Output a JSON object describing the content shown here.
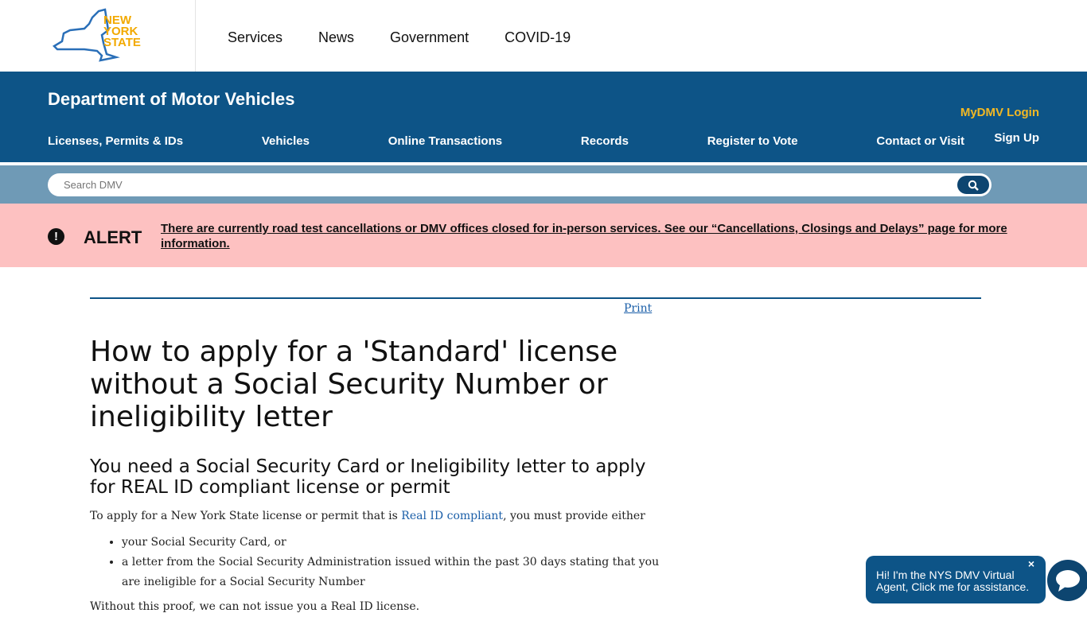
{
  "header": {
    "logo_text": "NEW YORK STATE",
    "nav": [
      "Services",
      "News",
      "Government",
      "COVID-19"
    ]
  },
  "dmv": {
    "title": "Department of Motor Vehicles",
    "mydmv_login": "MyDMV Login",
    "sign_up": "Sign Up",
    "nav": [
      "Licenses, Permits & IDs",
      "Vehicles",
      "Online Transactions",
      "Records",
      "Register to Vote",
      "Contact or Visit"
    ]
  },
  "search": {
    "placeholder": "Search DMV"
  },
  "alert": {
    "label": "ALERT",
    "text": "There are currently road test cancellations or DMV offices closed for in-person services. See our “Cancellations, Closings and Delays” page for more information."
  },
  "content": {
    "print": "Print",
    "title": "How to apply for a 'Standard' license without a Social Security Number or ineligibility letter",
    "subtitle": "You need a Social Security Card or Ineligibility letter to apply for REAL ID compliant license or permit",
    "intro_before": "To apply for a New York State license or permit that is ",
    "intro_link": "Real ID compliant",
    "intro_after": ", you must provide either",
    "bullets": [
      "your Social Security Card, or",
      "a letter from the Social Security Administration issued within the past 30 days stating that you are ineligible for a Social Security Number"
    ],
    "after": "Without this proof, we can not issue you a Real ID license."
  },
  "chat": {
    "text": "Hi! I'm the NYS DMV Virtual Agent, Click me for assistance.",
    "close": "×"
  },
  "colors": {
    "brand": "#0d5487",
    "gold": "#f2b824",
    "alert_bg": "#fdc1c1"
  }
}
